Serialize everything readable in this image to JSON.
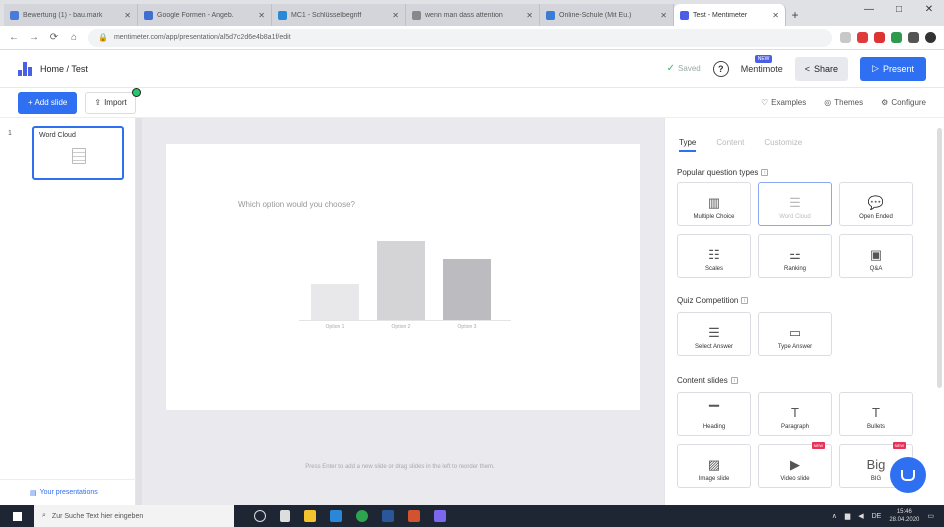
{
  "browser": {
    "tabs": [
      {
        "title": "Bewertung (1) - bau.mark",
        "color": "#4a7bd8",
        "active": false
      },
      {
        "title": "Google Formen - Angeb.",
        "color": "#3f6fd0",
        "active": false
      },
      {
        "title": "MC1 - Schlüsselbegriff",
        "color": "#2a88d8",
        "active": false
      },
      {
        "title": "wenn man dass attention",
        "color": "#888888",
        "active": false
      },
      {
        "title": "Online-Schule (Mit Eu.)",
        "color": "#3a7bd5",
        "active": false
      },
      {
        "title": "Test - Mentimeter",
        "color": "#4a5fe6",
        "active": true
      }
    ],
    "new_tab": "+",
    "win_min": "—",
    "win_max": "□",
    "win_close": "✕",
    "url": "mentimeter.com/app/presentation/al5d7c2d6e4b8a1f/edit",
    "back": "←",
    "forward": "→",
    "reload": "⟳",
    "home": "⌂"
  },
  "header": {
    "breadcrumb": "Home / Test",
    "saved": "Saved",
    "help": "?",
    "brand": "Mentimote",
    "brand_badge": "NEW",
    "share": "Share",
    "present": "Present"
  },
  "toolbar": {
    "add_slide": "+ Add slide",
    "import": "Import",
    "examples": "Examples",
    "themes": "Themes",
    "configure": "Configure"
  },
  "slides_panel": {
    "slide_number": "1",
    "slide_title": "Word Cloud",
    "your_presentations": "Your presentations"
  },
  "canvas": {
    "question": "Which option would you choose?",
    "hint": "Press Enter to add a new slide or drag slides in the left to reorder them.",
    "chart_data": {
      "type": "bar",
      "categories": [
        "Option 1",
        "Option 2",
        "Option 3"
      ],
      "values": [
        4,
        8.8,
        6.8
      ],
      "ylim": [
        0,
        10
      ],
      "colors": [
        "#e8e8ea",
        "#d4d4d7",
        "#bcbcc0"
      ]
    }
  },
  "right_panel": {
    "tabs": [
      {
        "label": "Type",
        "active": true
      },
      {
        "label": "Content",
        "active": false
      },
      {
        "label": "Customize",
        "active": false
      }
    ],
    "popular_title": "Popular question types",
    "quiz_title": "Quiz Competition",
    "content_title": "Content slides",
    "popular": [
      {
        "label": "Multiple Choice",
        "icon": "bar-chart-icon",
        "glyph": "▥"
      },
      {
        "label": "Word Cloud",
        "icon": "word-cloud-icon",
        "glyph": "☰",
        "selected": true
      },
      {
        "label": "Open Ended",
        "icon": "speech-bubbles-icon",
        "glyph": "💬"
      },
      {
        "label": "Scales",
        "icon": "sliders-icon",
        "glyph": "☷"
      },
      {
        "label": "Ranking",
        "icon": "ranking-icon",
        "glyph": "⚍"
      },
      {
        "label": "Q&A",
        "icon": "qa-icon",
        "glyph": "▣"
      }
    ],
    "quiz": [
      {
        "label": "Select Answer",
        "icon": "select-answer-icon",
        "glyph": "☰"
      },
      {
        "label": "Type Answer",
        "icon": "type-answer-icon",
        "glyph": "▭"
      }
    ],
    "content": [
      {
        "label": "Heading",
        "icon": "heading-icon",
        "glyph": "▔"
      },
      {
        "label": "Paragraph",
        "icon": "paragraph-icon",
        "glyph": "T"
      },
      {
        "label": "Bullets",
        "icon": "bullets-icon",
        "glyph": "T"
      },
      {
        "label": "Image slide",
        "icon": "image-icon",
        "glyph": "▨"
      },
      {
        "label": "Video slide",
        "icon": "video-icon",
        "glyph": "▶",
        "tag": "NEW"
      },
      {
        "label": "BIG",
        "icon": "big-text-icon",
        "glyph": "Big",
        "tag": "NEW"
      }
    ],
    "new_tag": "NEW"
  },
  "taskbar": {
    "search_placeholder": "Zur Suche Text hier eingeben",
    "time": "15:46",
    "date": "28.04.2020",
    "lang": "DE"
  }
}
